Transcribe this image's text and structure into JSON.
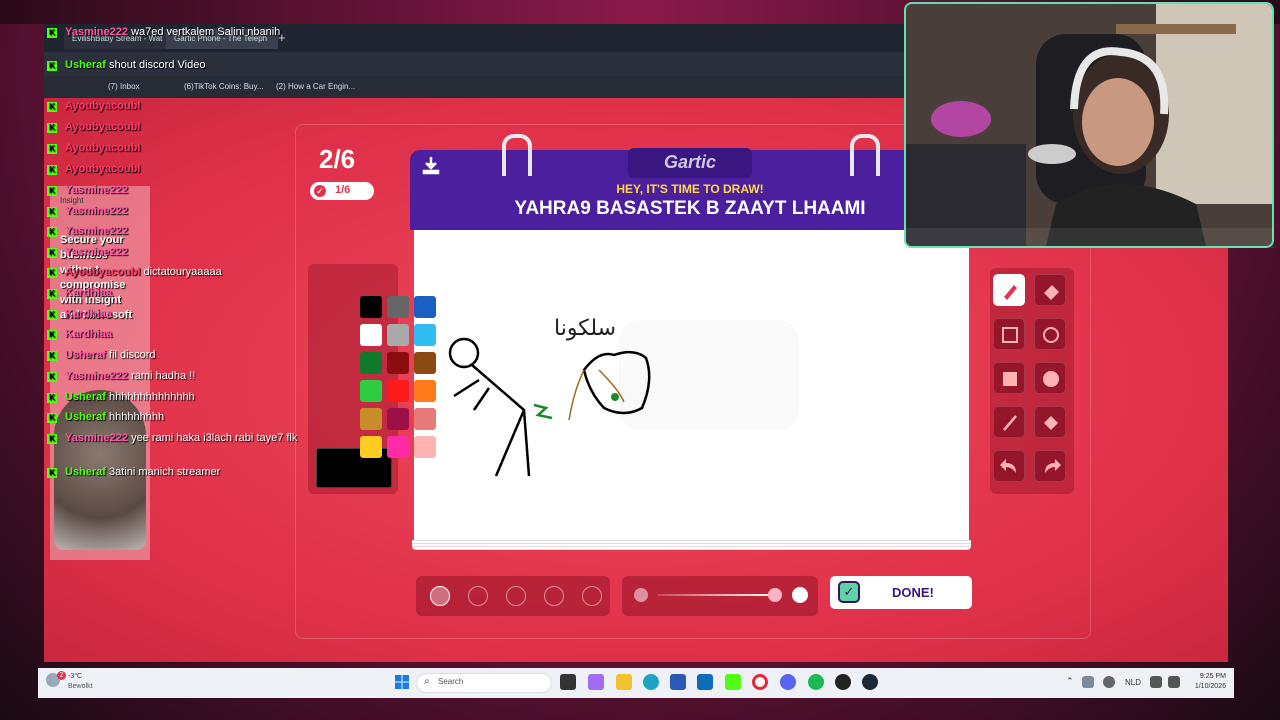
{
  "browser": {
    "tabs": [
      "EvilishBaby Stream - Wat",
      "Gartic Phone - The Teleph"
    ],
    "bookmarks": [
      "(7) Inbox",
      "(6)TikTok Coins: Buy...",
      "(2) How a Car Engin..."
    ]
  },
  "game": {
    "round": "2/6",
    "progress": "1/6",
    "logo": "Gartic",
    "prompt_small": "HEY, IT'S TIME TO DRAW!",
    "prompt": "YAHRA9 BASASTEK B ZAAYT LHAAMI",
    "done_label": "DONE!",
    "palette": [
      "#000000",
      "#666666",
      "#1a5fc4",
      "#ffffff",
      "#aaaaaa",
      "#2fbcf0",
      "#0f7a2c",
      "#8b0e0e",
      "#8a4a12",
      "#2ecc40",
      "#ff1a1a",
      "#ff7a1a",
      "#c98c2a",
      "#9c1048",
      "#e87a7a",
      "#ffcc22",
      "#ff2aa6",
      "#ffb3b3"
    ],
    "current_color": "#000000",
    "drawing_text": "سلكونا"
  },
  "chat": [
    {
      "name": "Yasmine222",
      "text": "wa7ed vertkalem Salini nbanih",
      "color": "#ff5aa8"
    },
    {
      "name": "Usheraf",
      "text": "shout discord Video",
      "color": "#53fc18"
    },
    {
      "name": "AyoubyacoubI",
      "text": "",
      "color": "#ff3a6a"
    },
    {
      "name": "AyoubyacoubI",
      "text": "",
      "color": "#ff3a6a"
    },
    {
      "name": "AyoubyacoubI",
      "text": "",
      "color": "#ff3a6a"
    },
    {
      "name": "AyoubyacoubI",
      "text": "",
      "color": "#ff3a6a"
    },
    {
      "name": "Yasmine222",
      "text": "",
      "color": "#ff5aa8"
    },
    {
      "name": "Yasmine222",
      "text": "",
      "color": "#ff5aa8"
    },
    {
      "name": "Yasmine222",
      "text": "",
      "color": "#ff5aa8"
    },
    {
      "name": "Yasmine222",
      "text": "",
      "color": "#ff5aa8"
    },
    {
      "name": "AyoubyacoubI",
      "text": "dictatouryaaaaa",
      "color": "#ff3a6a"
    },
    {
      "name": "Kardhiaa",
      "text": "",
      "color": "#ff5aa8"
    },
    {
      "name": "Kardhiaa",
      "text": "",
      "color": "#ff5aa8"
    },
    {
      "name": "Kardhiaa",
      "text": "",
      "color": "#ff5aa8"
    },
    {
      "name": "Usheraf",
      "text": "fil discord",
      "color": "#ff5aa8"
    },
    {
      "name": "Yasmine222",
      "text": "rami hadha !!",
      "color": "#ff5aa8"
    },
    {
      "name": "Usheraf",
      "text": "hhhhhhhhhhhhhh",
      "color": "#53fc18"
    },
    {
      "name": "Usheraf",
      "text": "hhhhhhhhh",
      "color": "#53fc18"
    },
    {
      "name": "Yasmine222",
      "text": "yee rami haka i3lach rabi taye7 flk",
      "color": "#ff5aa8"
    },
    {
      "name": "Usheraf",
      "text": "3atini manich streamer",
      "color": "#53fc18"
    }
  ],
  "ad": {
    "line1": "Secure your",
    "line2": "business",
    "line3": "without",
    "line4": "compromise",
    "line5": "with Insight",
    "line6": "and Microsoft",
    "brand": "Insight"
  },
  "taskbar": {
    "weather_temp": "-3°C",
    "weather_desc": "Bewolkt",
    "weather_badge": "2",
    "search_placeholder": "Search",
    "lang": "NLD",
    "time": "9:25 PM",
    "date": "1/10/2026"
  }
}
